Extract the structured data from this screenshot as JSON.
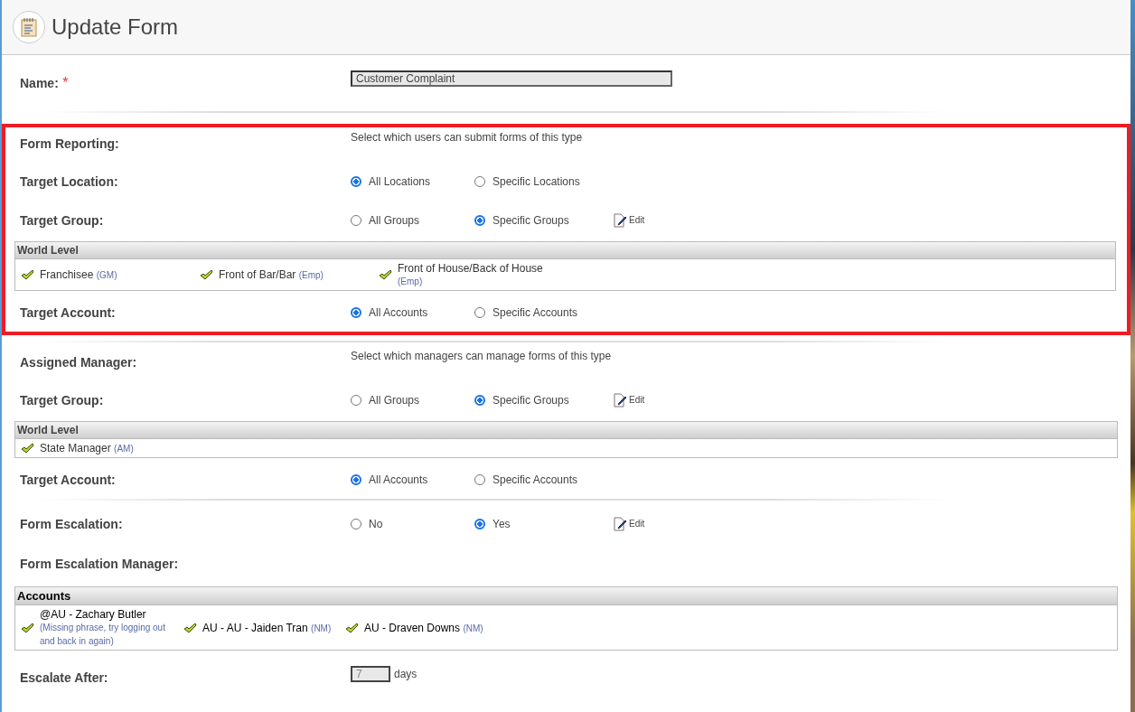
{
  "header": {
    "title": "Update Form"
  },
  "sections": [
    {
      "highlighted": false,
      "rows": [
        {
          "kind": "text",
          "label": "Name:",
          "required_mark": "*",
          "value": "Customer Complaint"
        }
      ]
    },
    {
      "highlighted": true,
      "rows": [
        {
          "kind": "note",
          "label": "Form Reporting:",
          "note": "Select which users can submit forms of this type"
        },
        {
          "kind": "radio",
          "label": "Target Location:",
          "options": [
            {
              "label": "All Locations",
              "selected": true
            },
            {
              "label": "Specific Locations",
              "selected": false
            }
          ]
        },
        {
          "kind": "radio",
          "label": "Target Group:",
          "options": [
            {
              "label": "All Groups",
              "selected": false
            },
            {
              "label": "Specific Groups",
              "selected": true
            }
          ],
          "edit": "Edit"
        },
        {
          "kind": "list",
          "header": "World Level",
          "items": [
            {
              "name": "Franchisee",
              "role": "(GM)"
            },
            {
              "name": "Front of Bar/Bar",
              "role": "(Emp)"
            },
            {
              "name": "Front of House/Back of House",
              "role": "(Emp)"
            }
          ]
        },
        {
          "kind": "radio",
          "label": "Target Account:",
          "options": [
            {
              "label": "All Accounts",
              "selected": true
            },
            {
              "label": "Specific Accounts",
              "selected": false
            }
          ]
        }
      ]
    },
    {
      "highlighted": false,
      "rows": [
        {
          "kind": "note",
          "label": "Assigned Manager:",
          "note": "Select which managers can manage forms of this type"
        },
        {
          "kind": "radio",
          "label": "Target Group:",
          "options": [
            {
              "label": "All Groups",
              "selected": false
            },
            {
              "label": "Specific Groups",
              "selected": true
            }
          ],
          "edit": "Edit"
        },
        {
          "kind": "list",
          "header": "World Level",
          "items": [
            {
              "name": "State Manager",
              "role": "(AM)"
            }
          ]
        },
        {
          "kind": "radio",
          "label": "Target Account:",
          "options": [
            {
              "label": "All Accounts",
              "selected": true
            },
            {
              "label": "Specific Accounts",
              "selected": false
            }
          ]
        }
      ]
    },
    {
      "highlighted": false,
      "rows": [
        {
          "kind": "radio",
          "label": "Form Escalation:",
          "options": [
            {
              "label": "No",
              "selected": false
            },
            {
              "label": "Yes",
              "selected": true
            }
          ],
          "edit": "Edit"
        },
        {
          "kind": "note",
          "label": "Form Escalation Manager:"
        },
        {
          "kind": "accounts",
          "header": "Accounts",
          "items": [
            {
              "name": "@AU - Zachary Butler",
              "role": "(Missing phrase, try logging out and back in again)"
            },
            {
              "name": "AU - AU - Jaiden Tran",
              "role": "(NM)"
            },
            {
              "name": "AU - Draven Downs",
              "role": "(NM)"
            }
          ]
        },
        {
          "kind": "number",
          "label": "Escalate After:",
          "value": "7",
          "unit": "days"
        }
      ]
    }
  ]
}
